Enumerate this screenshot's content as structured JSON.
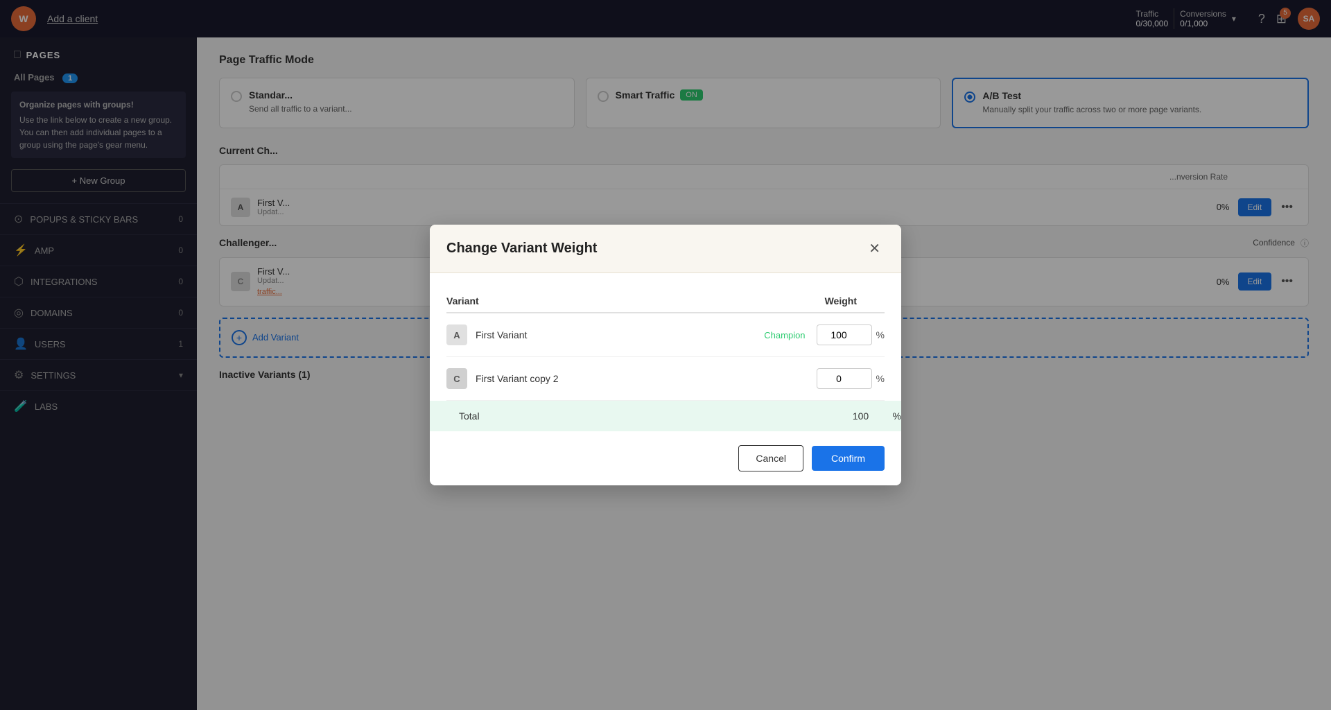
{
  "topNav": {
    "logoText": "W",
    "addClientText": "Add a client",
    "traffic": {
      "label": "Traffic",
      "value": "0/30,000"
    },
    "conversions": {
      "label": "Conversions",
      "value": "0/1,000"
    },
    "helpIcon": "?",
    "notificationBadge": "5",
    "avatarText": "SA"
  },
  "sidebar": {
    "pages": {
      "title": "PAGES",
      "icon": "□"
    },
    "allPages": {
      "label": "All Pages",
      "badge": "1"
    },
    "infoText": "Organize pages with groups!",
    "infoDesc": "Use the link below to create a new group. You can then add individual pages to a group using the page's gear menu.",
    "newGroupBtn": "+ New Group",
    "navItems": [
      {
        "icon": "⊙",
        "label": "POPUPS & STICKY BARS",
        "badge": "0"
      },
      {
        "icon": "⚡",
        "label": "AMP",
        "badge": "0"
      },
      {
        "icon": "⬡",
        "label": "INTEGRATIONS",
        "badge": "0"
      },
      {
        "icon": "◎",
        "label": "DOMAINS",
        "badge": "0"
      },
      {
        "icon": "👤",
        "label": "USERS",
        "badge": "1"
      },
      {
        "icon": "⚙",
        "label": "SETTINGS",
        "arrow": "▾"
      },
      {
        "icon": "🧪",
        "label": "LABS",
        "badge": ""
      }
    ]
  },
  "content": {
    "pageTrafficModeTitle": "Page Traffic Mode",
    "trafficCards": [
      {
        "id": "standard",
        "label": "Standard",
        "desc": "Send all traffic to a single page variant",
        "selected": false
      },
      {
        "id": "smart",
        "label": "Smart Traffic",
        "desc": "",
        "selected": false,
        "badge": "ON"
      },
      {
        "id": "abtest",
        "label": "A/B Test",
        "desc": "Manually split your traffic across two or more page variants.",
        "selected": true
      }
    ],
    "currentChampion": "Current Ch...",
    "columns": {
      "conversionRate": "nversion Rate"
    },
    "firstVariant": {
      "label": "A",
      "name": "First V...",
      "updated": "Updat...",
      "rate": "0%"
    },
    "challengers": {
      "title": "Challenger...",
      "confidenceLabel": "Confidence",
      "firstVariantCopy": {
        "label": "C",
        "name": "First V...",
        "updated": "Updat...",
        "orangeLink": "traffic...",
        "rate": "0%"
      }
    },
    "addVariant": {
      "label": "Add Variant"
    },
    "inactiveVariants": {
      "title": "Inactive Variants (1)"
    }
  },
  "modal": {
    "title": "Change Variant Weight",
    "columns": {
      "variant": "Variant",
      "weight": "Weight"
    },
    "variants": [
      {
        "label": "A",
        "name": "First Variant",
        "champion": "Champion",
        "weight": "100"
      },
      {
        "label": "C",
        "name": "First Variant copy 2",
        "champion": "",
        "weight": "0"
      }
    ],
    "total": {
      "label": "Total",
      "value": "100",
      "percent": "%"
    },
    "cancelBtn": "Cancel",
    "confirmBtn": "Confirm"
  }
}
